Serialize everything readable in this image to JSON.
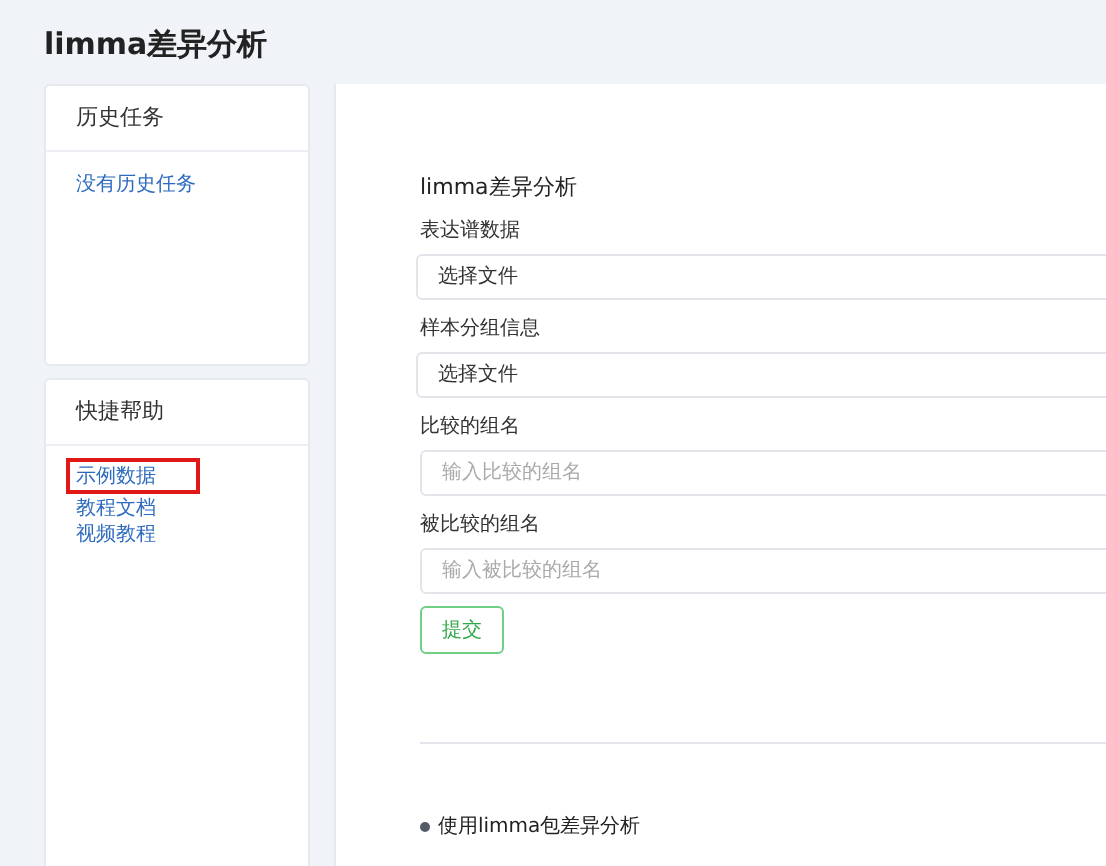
{
  "page_title": "limma差异分析",
  "history": {
    "title": "历史任务",
    "empty_text": "没有历史任务"
  },
  "help": {
    "title": "快捷帮助",
    "links": [
      {
        "label": "示例数据",
        "highlighted": true
      },
      {
        "label": "教程文档",
        "highlighted": false
      },
      {
        "label": "视频教程",
        "highlighted": false
      }
    ]
  },
  "form": {
    "title": "limma差异分析",
    "fields": [
      {
        "kind": "file",
        "label": "表达谱数据",
        "button": "选择文件"
      },
      {
        "kind": "file",
        "label": "样本分组信息",
        "button": "选择文件"
      },
      {
        "kind": "text",
        "label": "比较的组名",
        "placeholder": "输入比较的组名"
      },
      {
        "kind": "text",
        "label": "被比较的组名",
        "placeholder": "输入被比较的组名"
      }
    ],
    "submit": "提交"
  },
  "notes": [
    "使用limma包差异分析"
  ]
}
